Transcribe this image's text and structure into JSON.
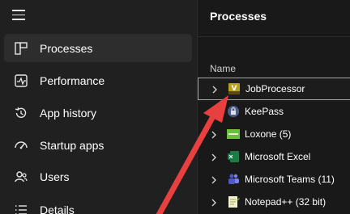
{
  "sidebar": {
    "menu_icon": "hamburger-menu-icon",
    "items": [
      {
        "label": "Processes",
        "icon": "processes-icon",
        "active": true
      },
      {
        "label": "Performance",
        "icon": "performance-icon",
        "active": false
      },
      {
        "label": "App history",
        "icon": "app-history-icon",
        "active": false
      },
      {
        "label": "Startup apps",
        "icon": "startup-apps-icon",
        "active": false
      },
      {
        "label": "Users",
        "icon": "users-icon",
        "active": false
      },
      {
        "label": "Details",
        "icon": "details-icon",
        "active": false
      }
    ]
  },
  "main": {
    "title": "Processes",
    "column_header": "Name",
    "processes": [
      {
        "name": "JobProcessor",
        "icon": "jobprocessor-icon",
        "selected": true
      },
      {
        "name": "KeePass",
        "icon": "keepass-icon",
        "selected": false
      },
      {
        "name": "Loxone (5)",
        "icon": "loxone-icon",
        "selected": false
      },
      {
        "name": "Microsoft Excel",
        "icon": "excel-icon",
        "selected": false
      },
      {
        "name": "Microsoft Teams (11)",
        "icon": "teams-icon",
        "selected": false
      },
      {
        "name": "Notepad++ (32 bit)",
        "icon": "notepadpp-icon",
        "selected": false
      }
    ]
  },
  "annotation": {
    "arrow_color": "#e8403f",
    "points_to": "JobProcessor"
  },
  "colors": {
    "background": "#202020",
    "main_background": "#191919",
    "active_item": "#2d2d2d",
    "selection_border": "#a7a7a7",
    "text": "#ffffff"
  }
}
